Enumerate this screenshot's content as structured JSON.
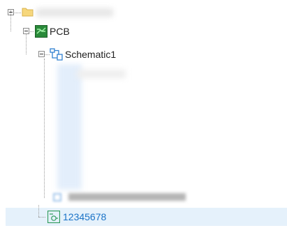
{
  "tree": {
    "root": {
      "label": "",
      "icon": "folder-icon"
    },
    "pcb": {
      "label": "PCB",
      "icon": "pcb-board-icon"
    },
    "schematic": {
      "label": "Schematic1",
      "icon": "schematic-icon"
    },
    "blurred_child": {
      "label": ""
    },
    "selected_item": {
      "label": "12345678",
      "icon": "component-icon"
    }
  },
  "colors": {
    "selection_bg": "#e5f1fb",
    "selected_text": "#1a73c7",
    "pcb_icon_bg": "#2a8a3a",
    "folder_icon": "#f6d77c",
    "schematic_icon": "#2f80d1",
    "component_icon": "#2d9a5a"
  }
}
